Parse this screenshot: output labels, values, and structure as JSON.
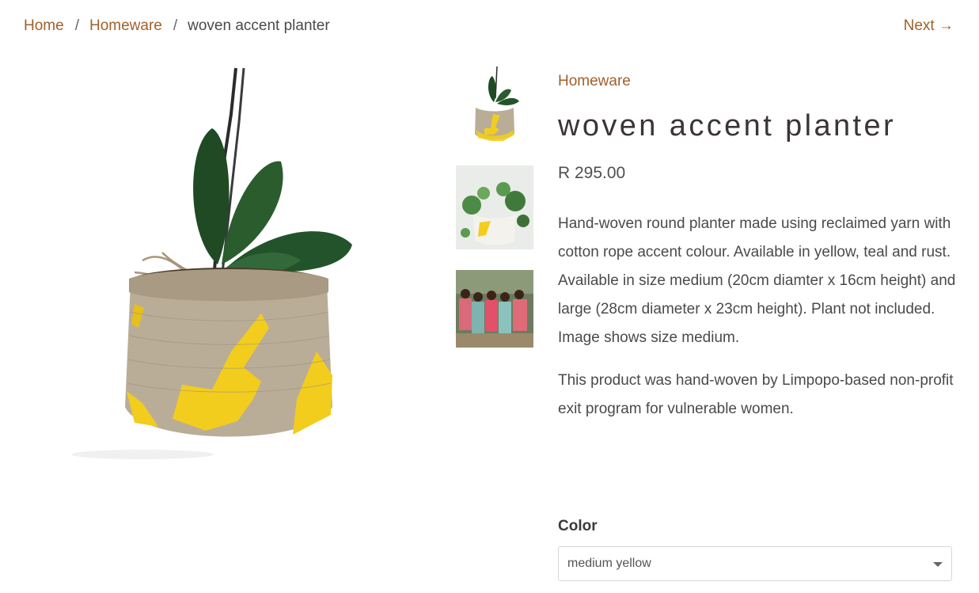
{
  "breadcrumb": {
    "home": "Home",
    "separator": "/",
    "collection": "Homeware",
    "current": "woven accent planter"
  },
  "next": "Next →",
  "product": {
    "collection": "Homeware",
    "title": "woven accent planter",
    "price": "R 295.00",
    "description": [
      "Hand-woven round planter made using reclaimed yarn with cotton rope accent colour.  Available in yellow, teal and rust.  Available in size medium (20cm diamter x 16cm height) and large (28cm diameter x 23cm height).  Plant not included.  Image shows size medium.",
      "This product was hand-woven by Limpopo-based non-profit exit program for vulnerable women."
    ]
  },
  "options": {
    "label": "Color",
    "selected": "medium yellow"
  },
  "colors": {
    "accent": "#a0612a",
    "yarn": "#f2cd1d",
    "basket": "#b9ad98"
  }
}
